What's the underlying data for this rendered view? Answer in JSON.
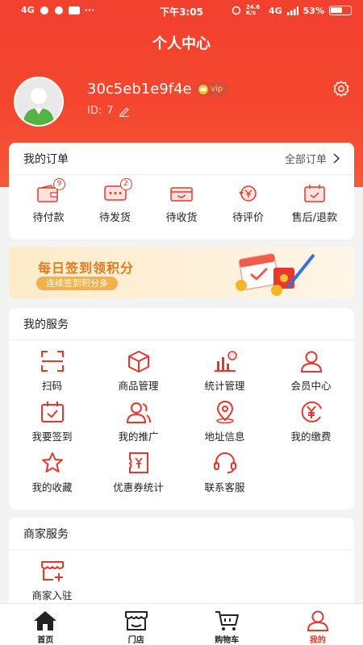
{
  "status_bar": {
    "left": "4G",
    "time": "下午3:05",
    "net": "24.6 K/s",
    "signal": "4G",
    "battery": "53%"
  },
  "header": {
    "title": "个人中心"
  },
  "profile": {
    "username": "30c5eb1e9f4e",
    "vip_label": "vip",
    "id_label": "ID:",
    "id_value": "7"
  },
  "orders": {
    "title": "我的订单",
    "all_label": "全部订单",
    "items": [
      {
        "label": "待付款",
        "icon": "wallet-icon",
        "badge": "9"
      },
      {
        "label": "待发货",
        "icon": "chat-box-icon",
        "badge": "2"
      },
      {
        "label": "待收货",
        "icon": "truck-box-icon",
        "badge": ""
      },
      {
        "label": "待评价",
        "icon": "yen-refresh-icon",
        "badge": ""
      },
      {
        "label": "售后/退款",
        "icon": "calendar-check-icon",
        "badge": ""
      }
    ]
  },
  "banner": {
    "title": "每日签到领积分",
    "subtitle": "连续签到积分多"
  },
  "services": {
    "title": "我的服务",
    "items": [
      {
        "label": "扫码",
        "icon": "scan-icon"
      },
      {
        "label": "商品管理",
        "icon": "box-icon"
      },
      {
        "label": "统计管理",
        "icon": "chart-icon"
      },
      {
        "label": "会员中心",
        "icon": "user-icon"
      },
      {
        "label": "我要签到",
        "icon": "calendar-check-icon"
      },
      {
        "label": "我的推广",
        "icon": "users-icon"
      },
      {
        "label": "地址信息",
        "icon": "location-icon"
      },
      {
        "label": "我的缴费",
        "icon": "yen-circle-icon"
      },
      {
        "label": "我的收藏",
        "icon": "star-icon"
      },
      {
        "label": "优惠券统计",
        "icon": "coupon-icon"
      },
      {
        "label": "联系客服",
        "icon": "headset-icon"
      }
    ]
  },
  "merchant": {
    "title": "商家服务",
    "items": [
      {
        "label": "商家入驻",
        "icon": "store-icon"
      }
    ]
  },
  "tabbar": {
    "items": [
      {
        "label": "首页",
        "icon": "home-icon"
      },
      {
        "label": "门店",
        "icon": "store-icon"
      },
      {
        "label": "购物车",
        "icon": "cart-icon"
      },
      {
        "label": "我的",
        "icon": "user-icon",
        "active": true
      }
    ]
  },
  "colors": {
    "accent": "#e3382b",
    "header": "#f2412f",
    "banner_text": "#e07a1f"
  }
}
